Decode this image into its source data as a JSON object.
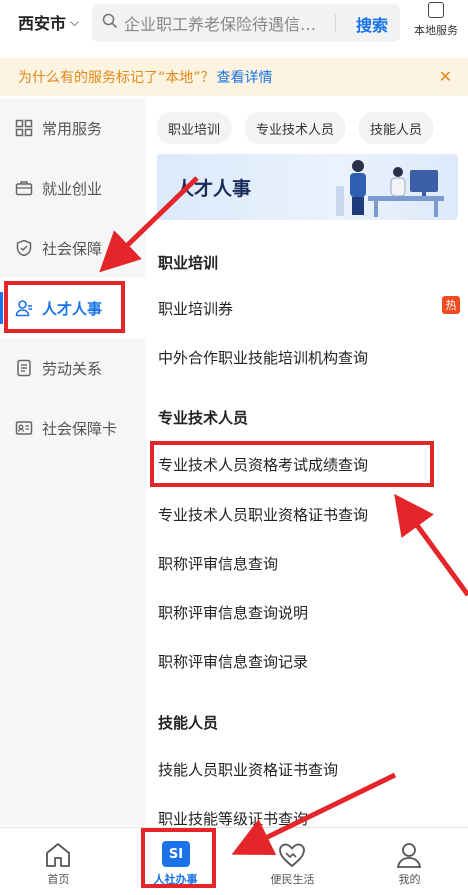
{
  "header": {
    "city": "西安市",
    "search_placeholder": "企业职工养老保险待遇信…",
    "search_button": "搜索",
    "local_service": "本地服务"
  },
  "notice": {
    "text": "为什么有的服务标记了“本地”？",
    "link": "查看详情"
  },
  "sidebar": {
    "items": [
      {
        "label": "常用服务",
        "icon": "grid-icon"
      },
      {
        "label": "就业创业",
        "icon": "briefcase-icon"
      },
      {
        "label": "社会保障",
        "icon": "shield-icon"
      },
      {
        "label": "人才人事",
        "icon": "person-icon",
        "active": true
      },
      {
        "label": "劳动关系",
        "icon": "document-icon"
      },
      {
        "label": "社会保障卡",
        "icon": "id-card-icon"
      }
    ]
  },
  "main": {
    "chips": [
      "职业培训",
      "专业技术人员",
      "技能人员"
    ],
    "banner_title": "人才人事",
    "sections": {
      "s1": "职业培训",
      "s2": "专业技术人员",
      "s3": "技能人员"
    },
    "rows": {
      "r1": "职业培训券",
      "r2": "中外合作职业技能培训机构查询",
      "r3": "专业技术人员资格考试成绩查询",
      "r4": "专业技术人员职业资格证书查询",
      "r5": "职称评审信息查询",
      "r6": "职称评审信息查询说明",
      "r7": "职称评审信息查询记录",
      "r8": "技能人员职业资格证书查询",
      "r9": "职业技能等级证书查询"
    },
    "hot_badge": "热"
  },
  "tabbar": {
    "home": "首页",
    "hrss": "人社办事",
    "hrss_badge": "SI",
    "life": "便民生活",
    "mine": "我的"
  },
  "colors": {
    "accent": "#1a73e8",
    "annotation": "#e4262a",
    "notice_text": "#e08a1a",
    "hot": "#f04a1f"
  }
}
